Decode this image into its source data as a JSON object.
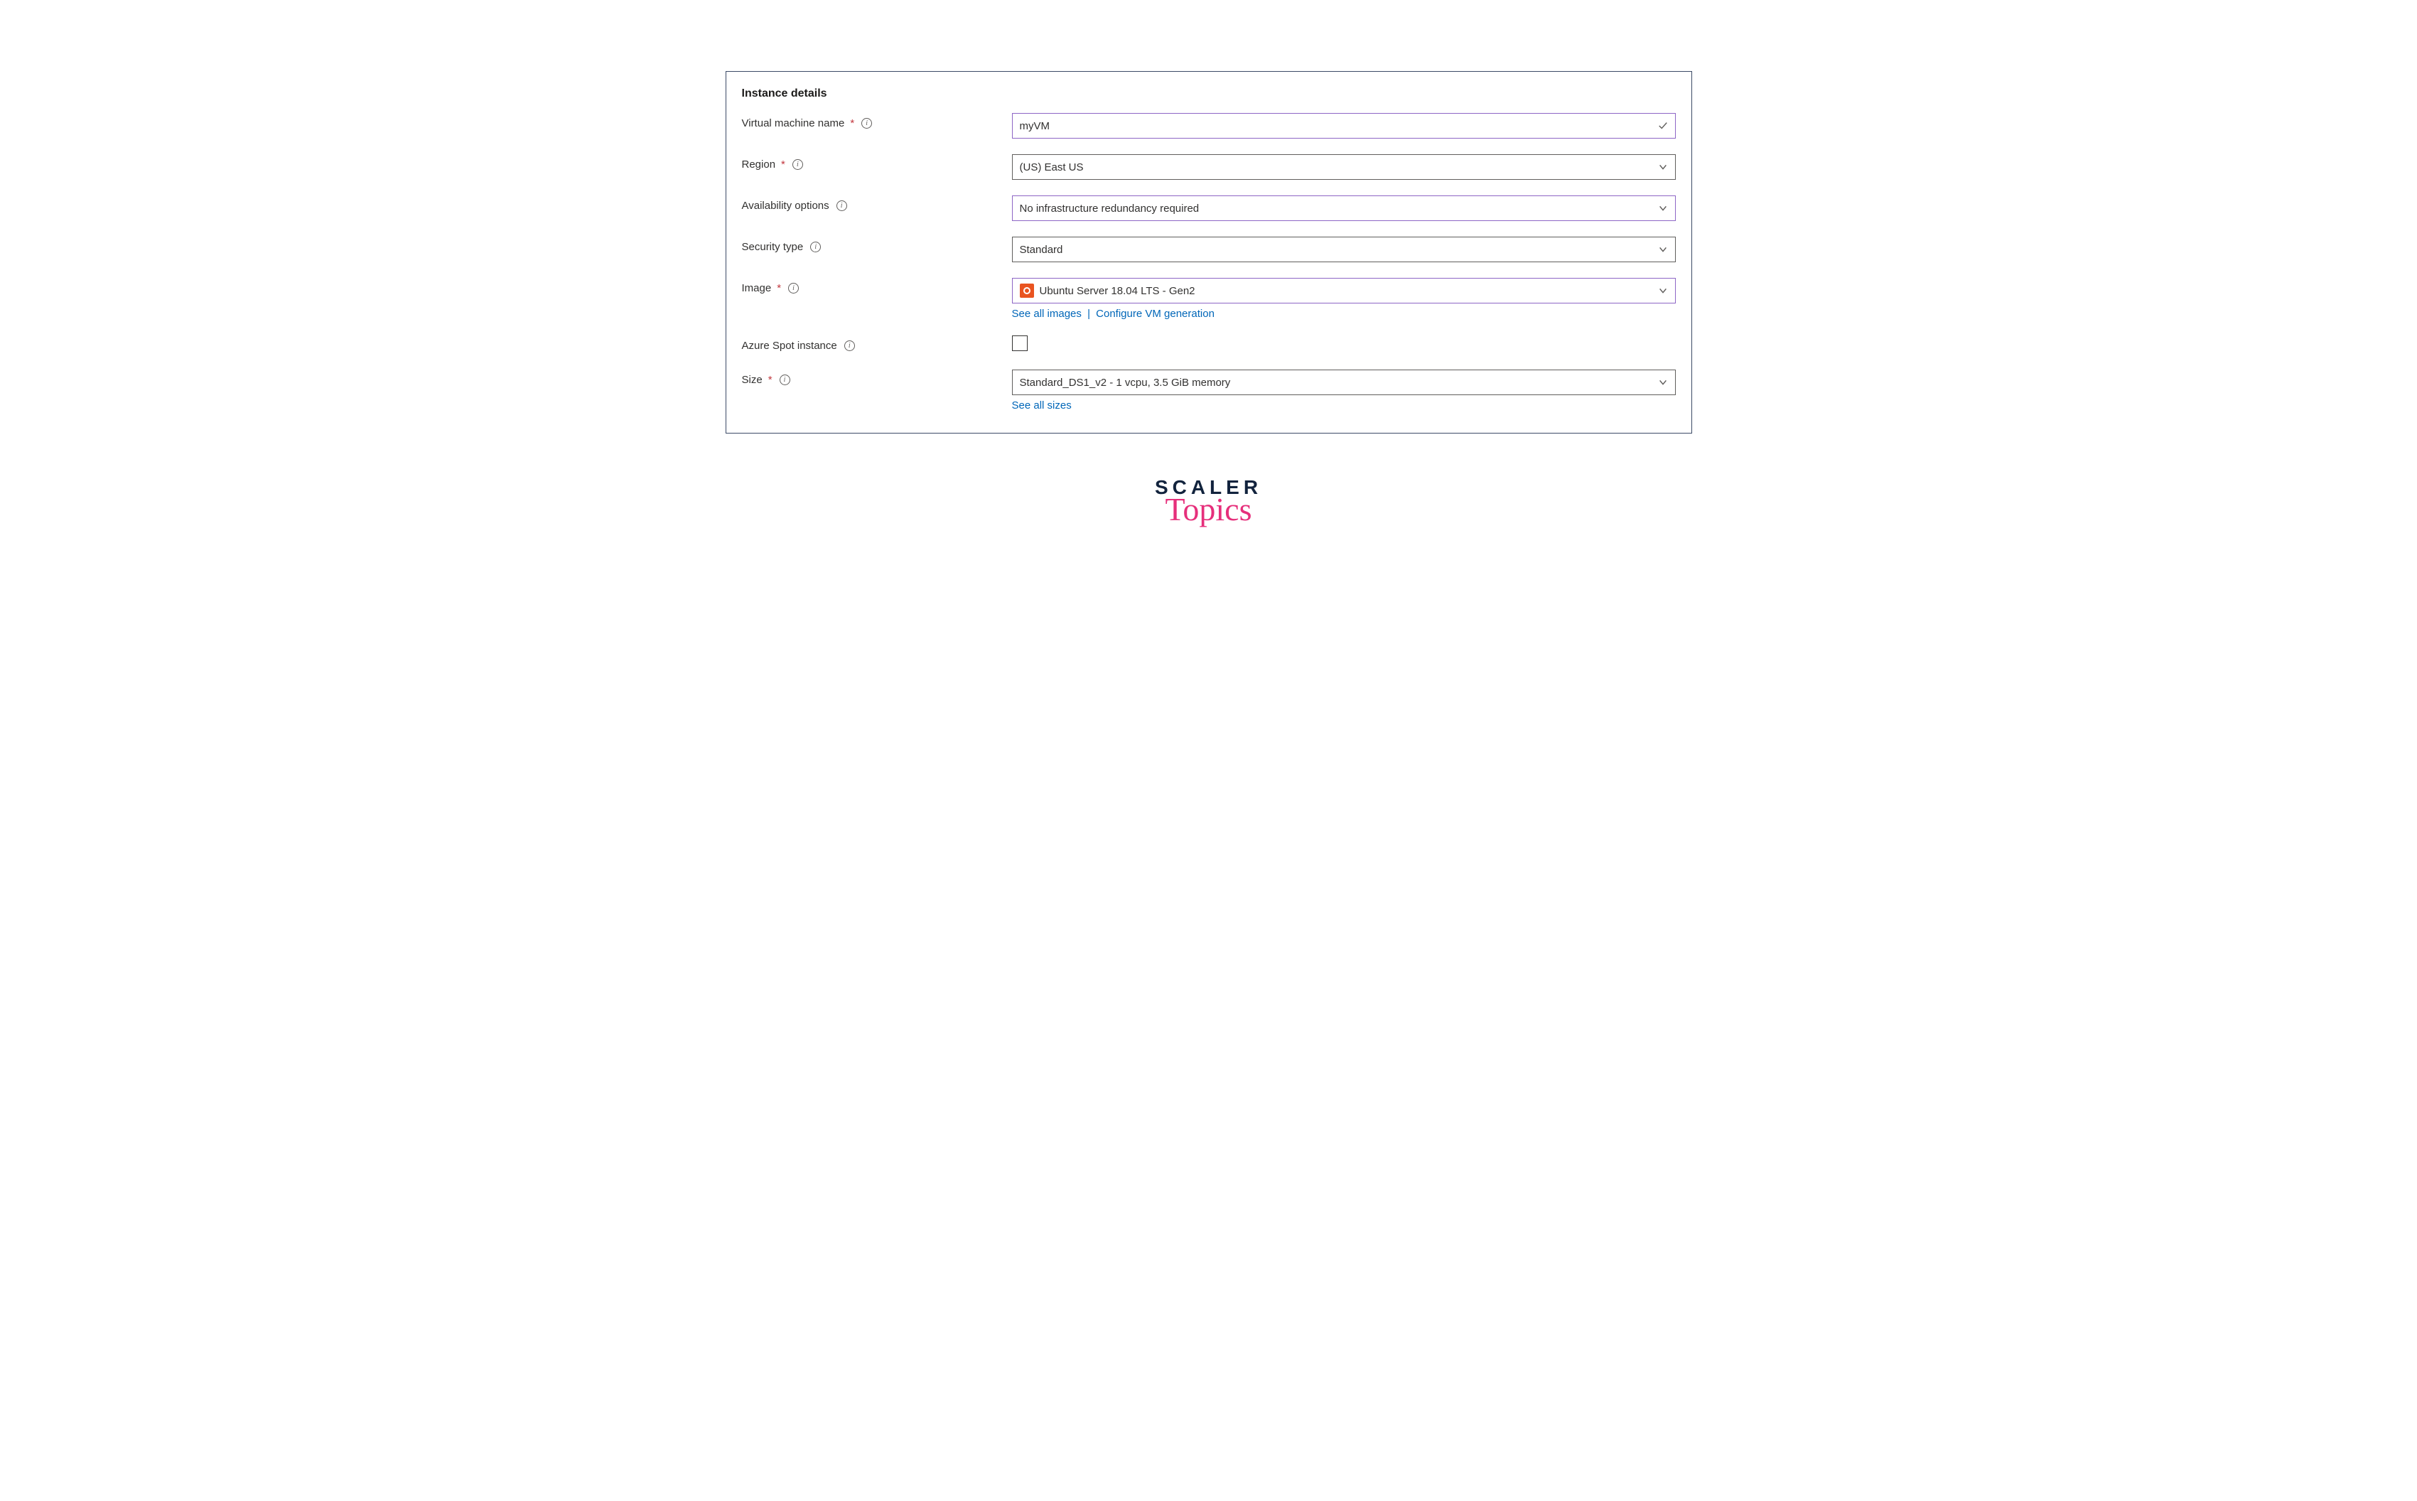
{
  "section_title": "Instance details",
  "fields": {
    "vm_name": {
      "label": "Virtual machine name",
      "required": true,
      "value": "myVM"
    },
    "region": {
      "label": "Region",
      "required": true,
      "value": "(US) East US"
    },
    "availability": {
      "label": "Availability options",
      "required": false,
      "value": "No infrastructure redundancy required"
    },
    "security": {
      "label": "Security type",
      "required": false,
      "value": "Standard"
    },
    "image": {
      "label": "Image",
      "required": true,
      "value": "Ubuntu Server 18.04 LTS - Gen2",
      "link_all": "See all images",
      "link_config": "Configure VM generation",
      "sep": "|"
    },
    "spot": {
      "label": "Azure Spot instance",
      "required": false,
      "checked": false
    },
    "size": {
      "label": "Size",
      "required": true,
      "value": "Standard_DS1_v2 - 1 vcpu, 3.5 GiB memory",
      "link_all": "See all sizes"
    }
  },
  "required_marker": "*",
  "brand": {
    "line1": "SCALER",
    "line2": "Topics"
  }
}
